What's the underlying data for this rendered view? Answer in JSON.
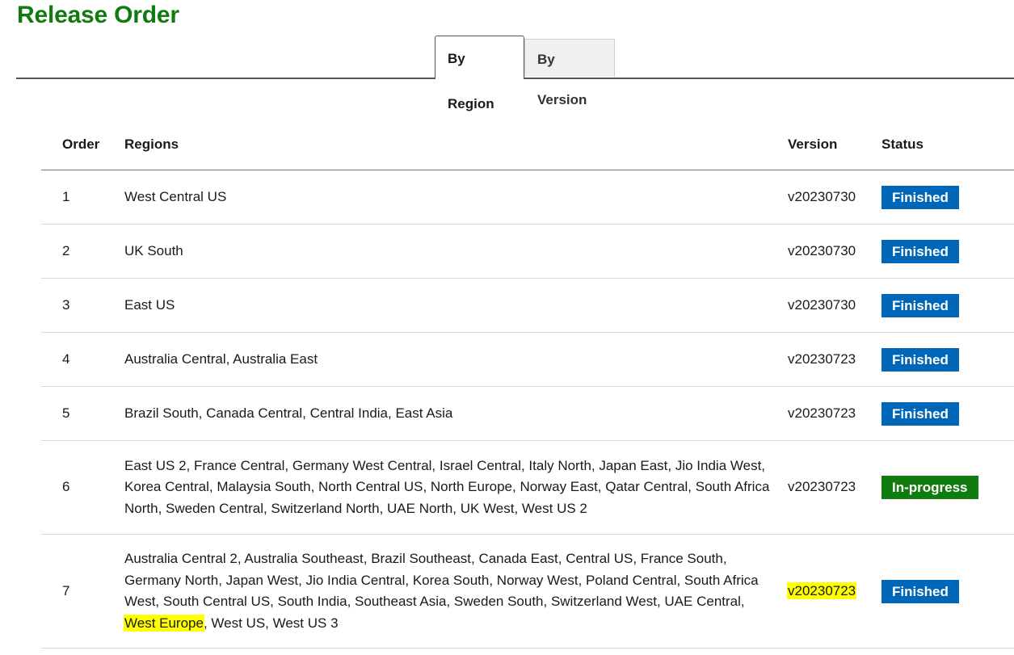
{
  "page": {
    "title": "Release Order"
  },
  "tabs": [
    {
      "label": "By Region",
      "active": true
    },
    {
      "label": "By Version",
      "active": false
    }
  ],
  "table": {
    "headers": {
      "order": "Order",
      "regions": "Regions",
      "version": "Version",
      "status": "Status"
    },
    "rows": [
      {
        "order": "1",
        "regions": "West Central US",
        "version": "v20230730",
        "status": "Finished"
      },
      {
        "order": "2",
        "regions": "UK South",
        "version": "v20230730",
        "status": "Finished"
      },
      {
        "order": "3",
        "regions": "East US",
        "version": "v20230730",
        "status": "Finished"
      },
      {
        "order": "4",
        "regions": "Australia Central, Australia East",
        "version": "v20230723",
        "status": "Finished"
      },
      {
        "order": "5",
        "regions": "Brazil South, Canada Central, Central India, East Asia",
        "version": "v20230723",
        "status": "Finished"
      },
      {
        "order": "6",
        "regions": "East US 2, France Central, Germany West Central, Israel Central, Italy North, Japan East, Jio India West, Korea Central, Malaysia South, North Central US, North Europe, Norway East, Qatar Central, South Africa North, Sweden Central, Switzerland North, UAE North, UK West, West US 2",
        "version": "v20230723",
        "status": "In-progress"
      },
      {
        "order": "7",
        "regions_pre": "Australia Central 2, Australia Southeast, Brazil Southeast, Canada East, Central US, France South, Germany North, Japan West, Jio India Central, Korea South, Norway West, Poland Central, South Africa West, South Central US, South India, Southeast Asia, Sweden South, Switzerland West, UAE Central, ",
        "regions_highlight": "West Europe",
        "regions_post": ", West US, West US 3",
        "version": "v20230723",
        "status": "Finished"
      }
    ]
  },
  "colors": {
    "title": "#107c10",
    "finished": "#0067b8",
    "in_progress": "#107c10",
    "highlight": "#ffff00"
  }
}
